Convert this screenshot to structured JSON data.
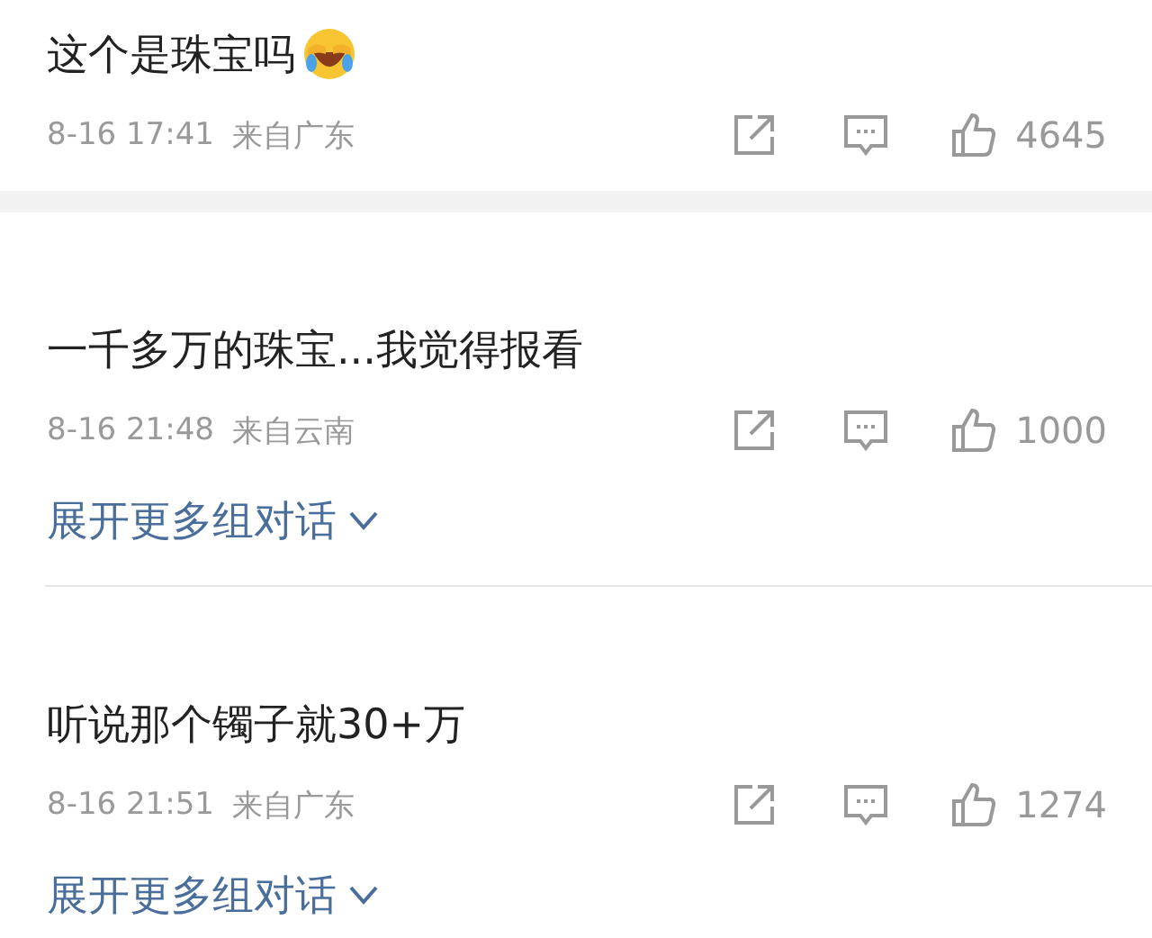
{
  "comments": [
    {
      "kind": "thick-gap",
      "text": "这个是珠宝吗",
      "has_emoji": true,
      "time": "8-16 17:41",
      "location": "来自广东",
      "likes": "4645"
    },
    {
      "kind": "thin-rule",
      "text": "一千多万的珠宝...我觉得报看",
      "has_emoji": false,
      "time": "8-16 21:48",
      "location": "来自云南",
      "likes": "1000",
      "expand_link": "展开更多组对话"
    },
    {
      "kind": "last",
      "text": "听说那个镯子就30+万",
      "has_emoji": false,
      "time": "8-16 21:51",
      "location": "来自广东",
      "likes": "1274",
      "expand_link": "展开更多组对话"
    }
  ]
}
